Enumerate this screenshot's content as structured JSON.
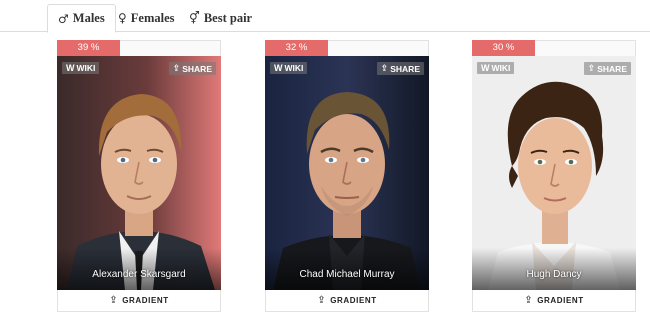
{
  "tabs": [
    {
      "label": "Males",
      "symbol": "♂",
      "active": true
    },
    {
      "label": "Females",
      "symbol": "♀",
      "active": false
    },
    {
      "label": "Best pair",
      "symbol": "⚥",
      "active": false
    }
  ],
  "cards": [
    {
      "percent": "39 %",
      "wiki": "WIKI",
      "share": "SHARE",
      "name": "Alexander Skarsgard",
      "gradient": "GRADIENT"
    },
    {
      "percent": "32 %",
      "wiki": "WIKI",
      "share": "SHARE",
      "name": "Chad Michael Murray",
      "gradient": "GRADIENT"
    },
    {
      "percent": "30 %",
      "wiki": "WIKI",
      "share": "SHARE",
      "name": "Hugh Dancy",
      "gradient": "GRADIENT"
    }
  ],
  "colors": {
    "percent_bar": "#e56b6b",
    "tab_border": "#dcdcdc",
    "card_border": "#e2e2e2"
  },
  "icons": {
    "wiki": "wikipedia-w-icon",
    "share": "share-icon",
    "gradient": "gradient-icon"
  }
}
